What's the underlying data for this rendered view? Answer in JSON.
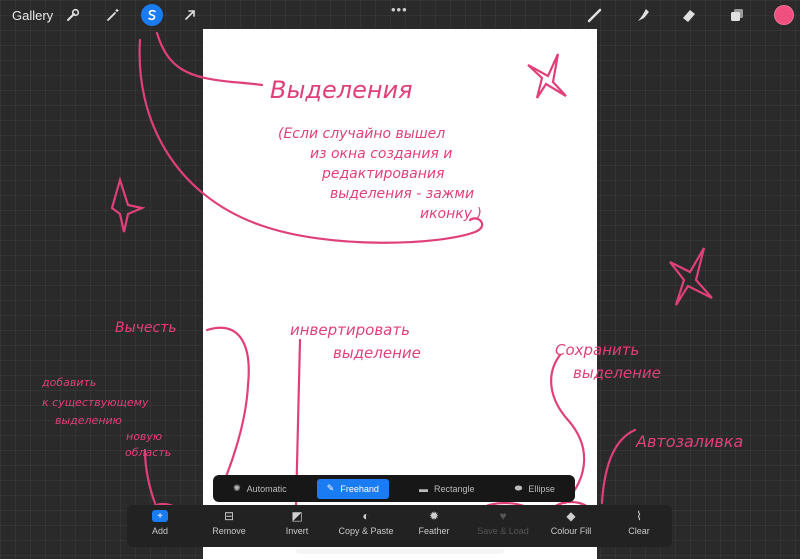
{
  "topbar": {
    "gallery_label": "Gallery",
    "dots": "•••",
    "tools": [
      "wrench-icon",
      "magic-wand-icon",
      "selection-icon",
      "transform-arrow-icon"
    ],
    "right_tools": [
      "brush-icon",
      "smudge-icon",
      "eraser-icon",
      "layers-icon"
    ],
    "current_color": "#f0507f"
  },
  "selection_modes": {
    "automatic": "Automatic",
    "freehand": "Freehand",
    "rectangle": "Rectangle",
    "ellipse": "Ellipse",
    "active": "Freehand"
  },
  "actions": {
    "add": "Add",
    "remove": "Remove",
    "invert": "Invert",
    "copy_paste": "Copy & Paste",
    "feather": "Feather",
    "save_load": "Save & Load",
    "colour_fill": "Colour Fill",
    "clear": "Clear"
  },
  "annotations": {
    "title": "Выделения",
    "note_line1": "(Если случайно вышел",
    "note_line2": "из окна создания и",
    "note_line3": "редактирования",
    "note_line4": "выделения - зажми",
    "note_line5": "иконку )",
    "eraser": "Вычесть",
    "invert_line1": "инвертировать",
    "invert_line2": "выделение",
    "save_line1": "Сохранить",
    "save_line2": "выделение",
    "add_line1": "добавить",
    "add_line2": "к существующему",
    "add_line3": "выделению",
    "add_line4": "новую",
    "add_line5": "область",
    "autofill": "Автозаливка"
  },
  "colors": {
    "accent": "#1a7cf2",
    "annotation": "#e0407a",
    "background": "#2a2a2a"
  }
}
